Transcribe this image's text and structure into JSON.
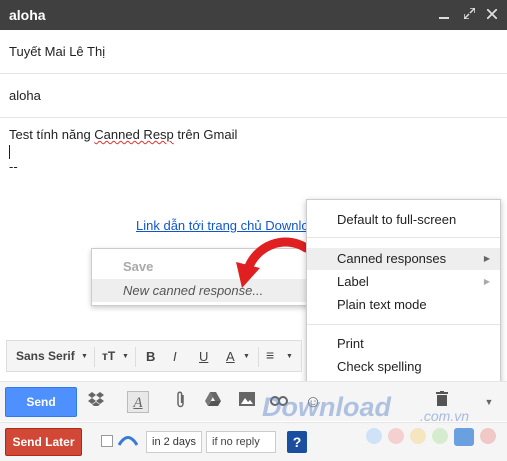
{
  "window": {
    "title": "aloha",
    "minimize_icon": "minimize-icon",
    "expand_icon": "expand-icon",
    "close_icon": "close-icon"
  },
  "compose": {
    "to": "Tuyết Mai Lê Thị",
    "subject": "aloha",
    "body_prefix": "Test tính năng ",
    "body_misspelled": "Canned Resp",
    "body_suffix": " trên Gmail",
    "signature_sep": "--",
    "link_text": "Link dẫn tới trang chủ Downlo"
  },
  "save_popup": {
    "save_label": "Save",
    "new_label": "New canned response..."
  },
  "menu": {
    "items": [
      {
        "label": "Default to full-screen"
      },
      {
        "label": "Canned responses",
        "submenu": true
      },
      {
        "label": "Label",
        "submenu": true
      },
      {
        "label": "Plain text mode"
      },
      {
        "label": "Print"
      },
      {
        "label": "Check spelling"
      }
    ]
  },
  "format_toolbar": {
    "font": "Sans Serif"
  },
  "buttons": {
    "send": "Send",
    "send_later": "Send Later"
  },
  "later": {
    "in_days": "in 2 days",
    "if_no_reply": "if no reply",
    "help": "?"
  },
  "watermark": {
    "text": "Download",
    "suffix": ".com.vn"
  },
  "colors": {
    "send_blue": "#4d90fe",
    "send_later_red": "#d14836",
    "title_bg": "#404040",
    "arrow_red": "#e02020"
  }
}
